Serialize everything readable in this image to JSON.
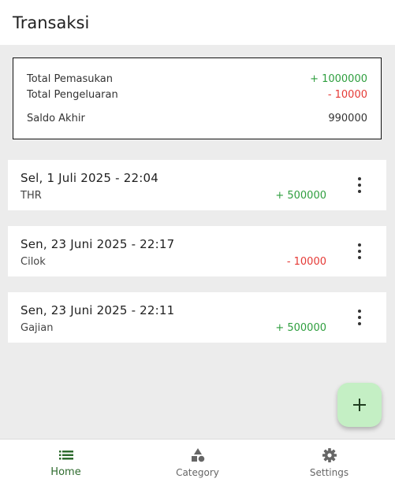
{
  "appbar": {
    "title": "Transaksi"
  },
  "summary": {
    "income_label": "Total Pemasukan",
    "income_value": "+ 1000000",
    "expense_label": "Total Pengeluaran",
    "expense_value": "- 10000",
    "balance_label": "Saldo Akhir",
    "balance_value": "990000"
  },
  "transactions": [
    {
      "date": "Sel, 1 Juli 2025 - 22:04",
      "name": "THR",
      "amount": "+ 500000",
      "type": "income"
    },
    {
      "date": "Sen, 23 Juni 2025 - 22:17",
      "name": "Cilok",
      "amount": "- 10000",
      "type": "expense"
    },
    {
      "date": "Sen, 23 Juni 2025 - 22:11",
      "name": "Gajian",
      "amount": "+ 500000",
      "type": "income"
    }
  ],
  "nav": [
    {
      "label": "Home",
      "icon": "list-icon",
      "active": true
    },
    {
      "label": "Category",
      "icon": "shapes-icon",
      "active": false
    },
    {
      "label": "Settings",
      "icon": "gear-icon",
      "active": false
    }
  ],
  "colors": {
    "income": "#2e9e3e",
    "expense": "#e53935",
    "accent": "#2e6b2e",
    "fab": "#c4efc4"
  }
}
